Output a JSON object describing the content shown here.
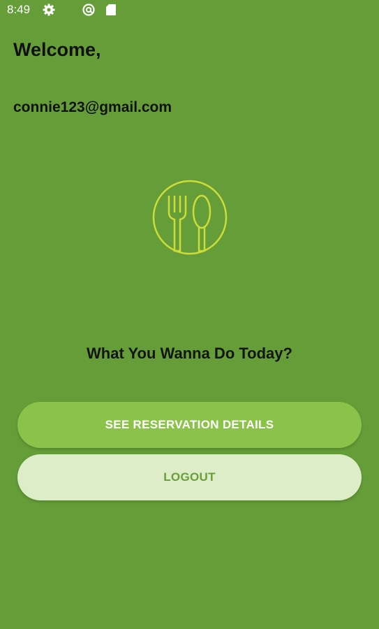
{
  "status_bar": {
    "time": "8:49",
    "icons": [
      "gear-icon",
      "at-sign-icon",
      "sd-card-icon"
    ]
  },
  "header": {
    "greeting": "Welcome,",
    "email": "connie123@gmail.com"
  },
  "logo": {
    "icon": "fork-spoon-icon",
    "color": "#cddc39"
  },
  "main": {
    "prompt": "What You Wanna Do Today?",
    "reservation_button": "SEE RESERVATION DETAILS",
    "logout_button": "LOGOUT"
  },
  "colors": {
    "background": "#659e38",
    "primary_button": "#8bc34a",
    "secondary_button": "#dcedc8",
    "secondary_button_text": "#689f38"
  }
}
